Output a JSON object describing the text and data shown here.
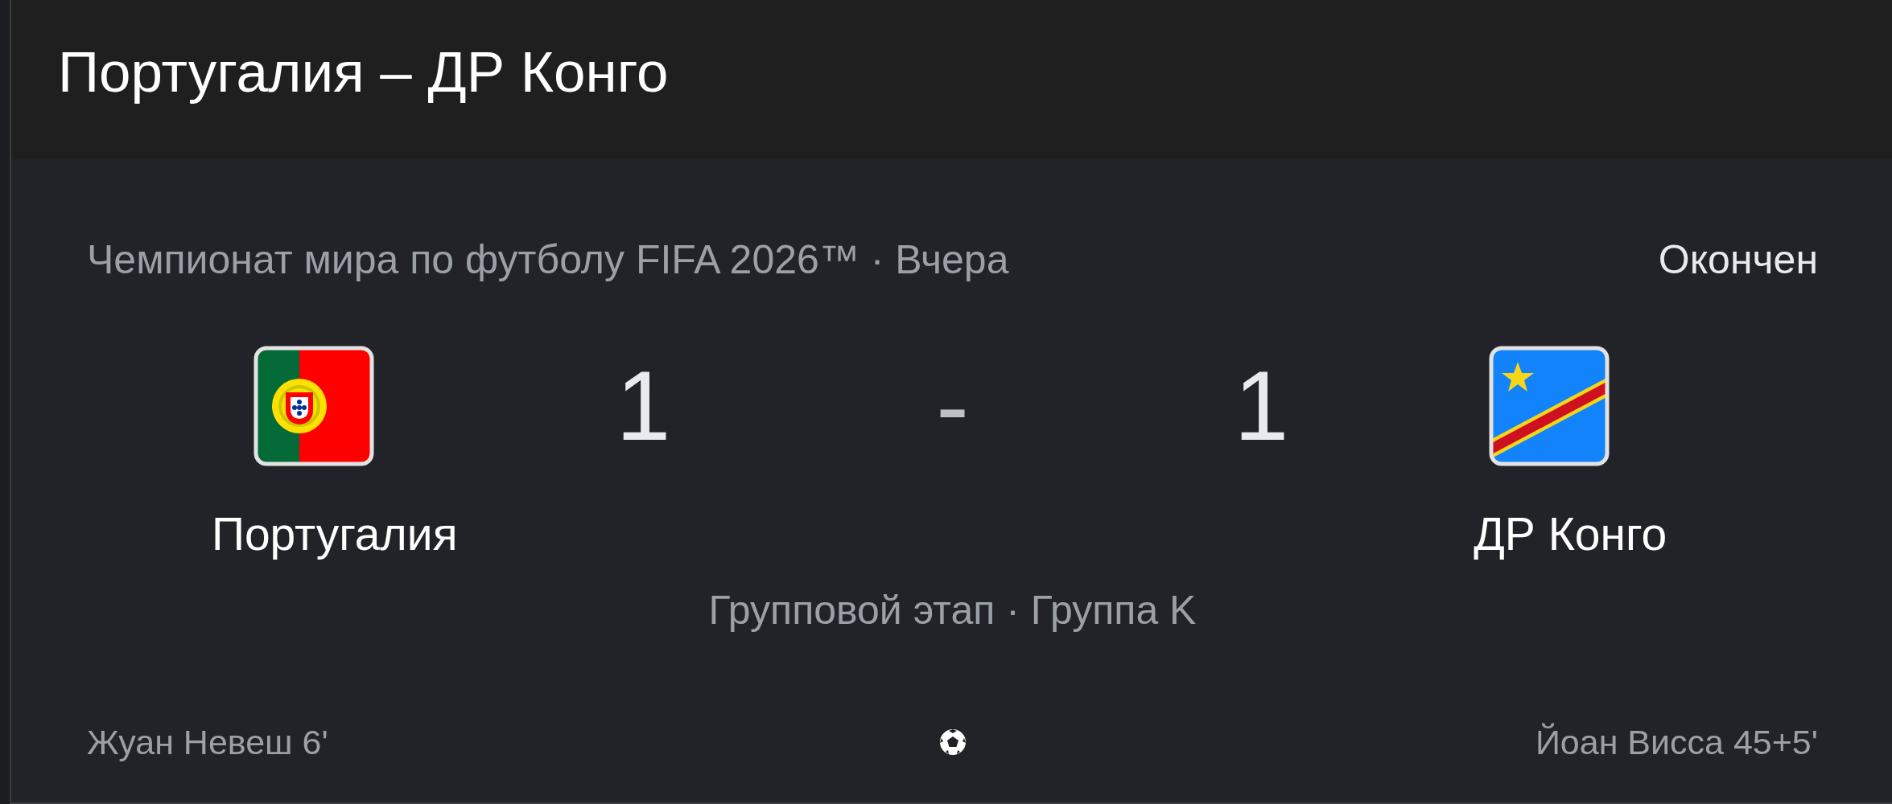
{
  "header": {
    "title": "Португалия – ДР Конго"
  },
  "match": {
    "competition": "Чемпионат мира по футболу FIFA 2026™ · Вчера",
    "status": "Окончен",
    "separator": "-",
    "stage": "Групповой этап · Группа K",
    "teams": [
      {
        "name": "Португалия",
        "score": "1",
        "scorers": [
          "Жуан Невеш 6'"
        ]
      },
      {
        "name": "ДР Конго",
        "score": "1",
        "scorers": [
          "Йоан Висса 45+5'"
        ]
      }
    ]
  }
}
